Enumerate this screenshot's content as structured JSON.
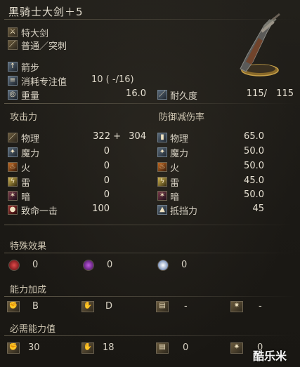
{
  "weapon": {
    "name": "黑骑士大剑＋5"
  },
  "info": {
    "category": "特大剑",
    "attack_type": "普通／突刺",
    "skill": "箭步",
    "fp_cost_label": "消耗专注值",
    "fp_cost_value": "10 (   -/16)",
    "weight_label": "重量",
    "weight_value": "16.0",
    "durability_label": "耐久度",
    "durability_current": "115/",
    "durability_max": "115"
  },
  "attack": {
    "heading": "攻击力",
    "rows": [
      {
        "label": "物理",
        "value": "322 +",
        "bonus": "304"
      },
      {
        "label": "魔力",
        "value": "0"
      },
      {
        "label": "火",
        "value": "0"
      },
      {
        "label": "雷",
        "value": "0"
      },
      {
        "label": "暗",
        "value": "0"
      },
      {
        "label": "致命一击",
        "value": "100"
      }
    ]
  },
  "defense": {
    "heading": "防御减伤率",
    "rows": [
      {
        "label": "物理",
        "value": "65.0"
      },
      {
        "label": "魔力",
        "value": "50.0"
      },
      {
        "label": "火",
        "value": "50.0"
      },
      {
        "label": "雷",
        "value": "45.0"
      },
      {
        "label": "暗",
        "value": "50.0"
      },
      {
        "label": "抵挡力",
        "value": "45"
      }
    ]
  },
  "special": {
    "heading": "特殊效果",
    "values": [
      "0",
      "0",
      "0"
    ],
    "colors": [
      "#b3232b",
      "#8a3bb0",
      "#d8e4ff"
    ]
  },
  "scaling": {
    "heading": "能力加成",
    "values": [
      "B",
      "D",
      "-",
      "-"
    ]
  },
  "requirements": {
    "heading": "必需能力值",
    "values": [
      "30",
      "18",
      "0",
      "0"
    ]
  },
  "watermark": "酷乐米"
}
